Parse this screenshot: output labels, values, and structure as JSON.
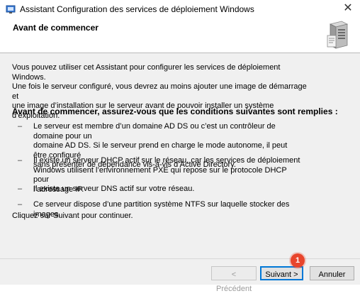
{
  "window": {
    "title": "Assistant Configuration des services de déploiement Windows",
    "close_glyph": "✕"
  },
  "header": {
    "title": "Avant de commencer",
    "icon": "server-icon"
  },
  "content": {
    "intro_lines": [
      "Vous pouvez utiliser cet Assistant pour configurer les services de déploiement Windows.",
      "Une fois le serveur configuré, vous devrez au moins ajouter une image de démarrage et",
      "une image d’installation sur le serveur avant de pouvoir installer un système d’exploitation."
    ],
    "subheading": "Avant de commencer, assurez-vous que les conditions suivantes sont remplies :",
    "requirements": [
      {
        "bullet": "–",
        "lines": [
          "Le serveur est membre d’un domaine AD DS ou c’est un contrôleur de domaine pour un",
          "domaine AD DS. Si le serveur prend en charge le mode autonome, il peut être configuré",
          "sans présenter de dépendance vis-à-vis d’Active Directory."
        ]
      },
      {
        "bullet": "–",
        "lines": [
          "Il existe un serveur DHCP actif sur le réseau, car les services de déploiement",
          "Windows utilisent l’environnement PXE qui repose sur le protocole DHCP pour",
          "l’adressage IP."
        ]
      },
      {
        "bullet": "–",
        "lines": [
          "Il existe un serveur DNS actif sur votre réseau."
        ]
      },
      {
        "bullet": "–",
        "lines": [
          "Ce serveur dispose d’une partition système NTFS sur laquelle stocker des images."
        ]
      }
    ],
    "outro": "Cliquez sur Suivant pour continuer."
  },
  "footer": {
    "prev_label": "< Précédent",
    "next_label": "Suivant >",
    "cancel_label": "Annuler"
  },
  "annotation": {
    "badge_number": "1",
    "badge_color": "#e8452c"
  }
}
